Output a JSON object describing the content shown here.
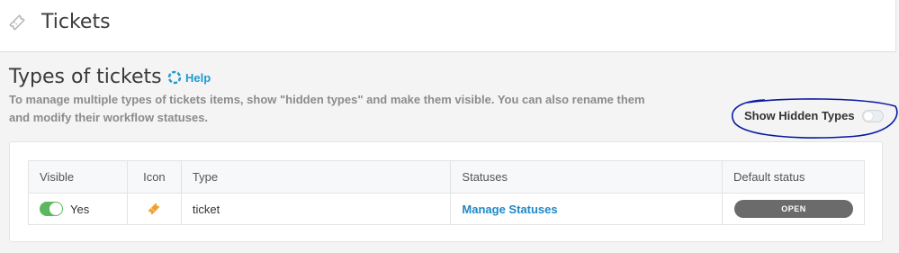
{
  "header": {
    "title": "Tickets",
    "icon": "ticket-icon"
  },
  "section": {
    "title": "Types of tickets",
    "help_label": "Help",
    "description": "To manage multiple types of tickets items, show \"hidden types\" and make them visible. You can also rename them and modify their workflow statuses."
  },
  "show_hidden": {
    "label": "Show Hidden Types",
    "enabled": false
  },
  "table": {
    "columns": [
      "Visible",
      "Icon",
      "Type",
      "Statuses",
      "Default status"
    ],
    "rows": [
      {
        "visible": true,
        "visible_label": "Yes",
        "icon": "ticket-icon",
        "type": "ticket",
        "statuses_link": "Manage Statuses",
        "default_status": "OPEN"
      }
    ]
  },
  "colors": {
    "accent": "#1e88c7",
    "toggle_on": "#5cb85c",
    "annotation": "#0a1aa0",
    "status_pill": "#6b6b6b",
    "ticket_icon": "#f0a030"
  }
}
